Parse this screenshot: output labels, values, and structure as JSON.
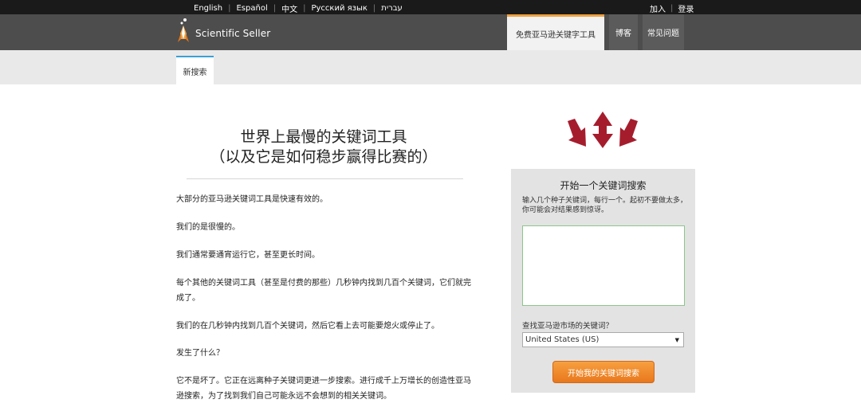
{
  "topbar": {
    "languages": [
      "English",
      "Español",
      "中文",
      "Русский язык",
      "עברית"
    ],
    "join": "加入",
    "login": "登录"
  },
  "header": {
    "logo_text": "Scientific Seller",
    "nav": [
      "免费亚马逊关键字工具",
      "博客",
      "常见问题"
    ]
  },
  "subnav": {
    "tab": "新搜索"
  },
  "article": {
    "headline_line1": "世界上最慢的关键词工具",
    "headline_line2": "（以及它是如何稳步赢得比赛的）",
    "paragraphs": [
      "大部分的亚马逊关键词工具是快速有效的。",
      "我们的是很慢的。",
      "我们通常要通宵运行它，甚至更长时间。",
      "每个其他的关键词工具（甚至是付费的那些）几秒钟内找到几百个关键词，它们就完成了。",
      "我们的在几秒钟内找到几百个关键词，然后它看上去可能要熄火或停止了。",
      "发生了什么？",
      "它不是坏了。它正在远离种子关键词更进一步搜索。进行成千上万增长的创造性亚马逊搜索，为了找到我们自己可能永远不会想到的相关关键词。"
    ]
  },
  "search": {
    "title": "开始一个关键词搜索",
    "hint": "输入几个种子关键词，每行一个。起初不要做太多，你可能会对结果感到惊讶。",
    "textarea_value": "",
    "market_label": "查找亚马逊市场的关键词？",
    "market_selected": "United States (US)",
    "button": "开始我的关键词搜索"
  },
  "colors": {
    "topbar": "#1a1a1a",
    "header": "#4d4d4d",
    "arrow": "#a51d2d",
    "button": "#ef8a2c",
    "tab_accent": "#3aa0d8"
  }
}
